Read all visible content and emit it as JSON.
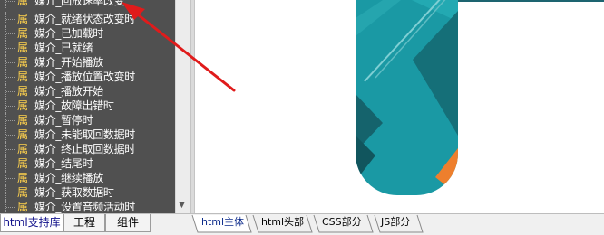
{
  "library_tree": {
    "prop_glyph": "属",
    "items": [
      {
        "label": "媒介_回放速率改变"
      },
      {
        "label": "媒介_就绪状态改变时"
      },
      {
        "label": "媒介_已加载时"
      },
      {
        "label": "媒介_已就绪"
      },
      {
        "label": "媒介_开始播放"
      },
      {
        "label": "媒介_播放位置改变时"
      },
      {
        "label": "媒介_播放开始"
      },
      {
        "label": "媒介_故障出错时"
      },
      {
        "label": "媒介_暂停时"
      },
      {
        "label": "媒介_未能取回数据时"
      },
      {
        "label": "媒介_终止取回数据时"
      },
      {
        "label": "媒介_结尾时"
      },
      {
        "label": "媒介_继续播放"
      },
      {
        "label": "媒介_获取数据时"
      },
      {
        "label": "媒介_设置音频活动时"
      }
    ]
  },
  "left_tabs": {
    "html_library": "html支持库",
    "project": "工程",
    "components": "组件"
  },
  "right_tabs": {
    "html_body": "html主体",
    "html_head": "html头部",
    "css_part": "CSS部分",
    "js_part": "JS部分"
  },
  "colors": {
    "tree_background": "#505050",
    "property_glyph": "#ffd24d",
    "annotation_arrow": "#e01b1b",
    "graphic_teal": "#1a99a4",
    "graphic_dark_teal": "#156f78",
    "graphic_orange": "#ee7f2d"
  }
}
